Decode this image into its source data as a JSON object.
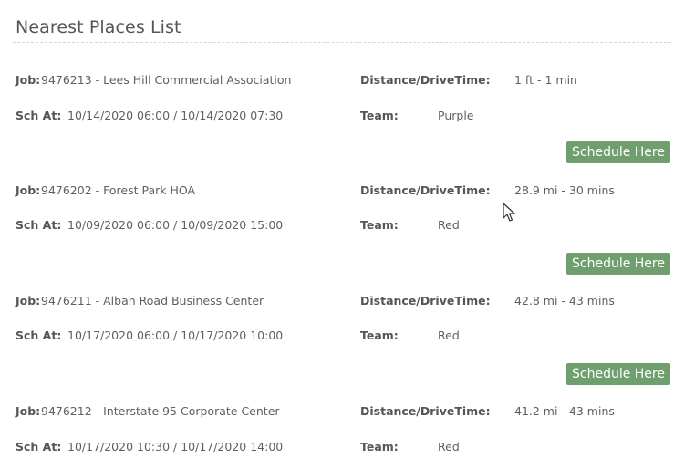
{
  "panel": {
    "title": "Nearest Places List"
  },
  "labels": {
    "job": "Job:",
    "sch_at": "Sch At:",
    "distance": "Distance/DriveTime:",
    "team": "Team:"
  },
  "schedule_button_label": "Schedule Here",
  "jobs": [
    {
      "job": "9476213 - Lees Hill Commercial Association",
      "sch_at": "10/14/2020 06:00 / 10/14/2020 07:30",
      "distance": "1 ft - 1 min",
      "team": "Purple"
    },
    {
      "job": "9476202 - Forest Park HOA",
      "sch_at": "10/09/2020 06:00 / 10/09/2020 15:00",
      "distance": "28.9 mi - 30 mins",
      "team": "Red"
    },
    {
      "job": "9476211 - Alban Road Business Center",
      "sch_at": "10/17/2020 06:00 / 10/17/2020 10:00",
      "distance": "42.8 mi - 43 mins",
      "team": "Red"
    },
    {
      "job": "9476212 - Interstate 95 Corporate Center",
      "sch_at": "10/17/2020 10:30 / 10/17/2020 14:00",
      "distance": "41.2 mi - 43 mins",
      "team": "Red"
    }
  ],
  "colors": {
    "button_bg": "#6f9e6f",
    "button_text": "#ffffff",
    "text": "#555555"
  },
  "icons": {
    "cursor": "mouse-pointer-icon"
  }
}
